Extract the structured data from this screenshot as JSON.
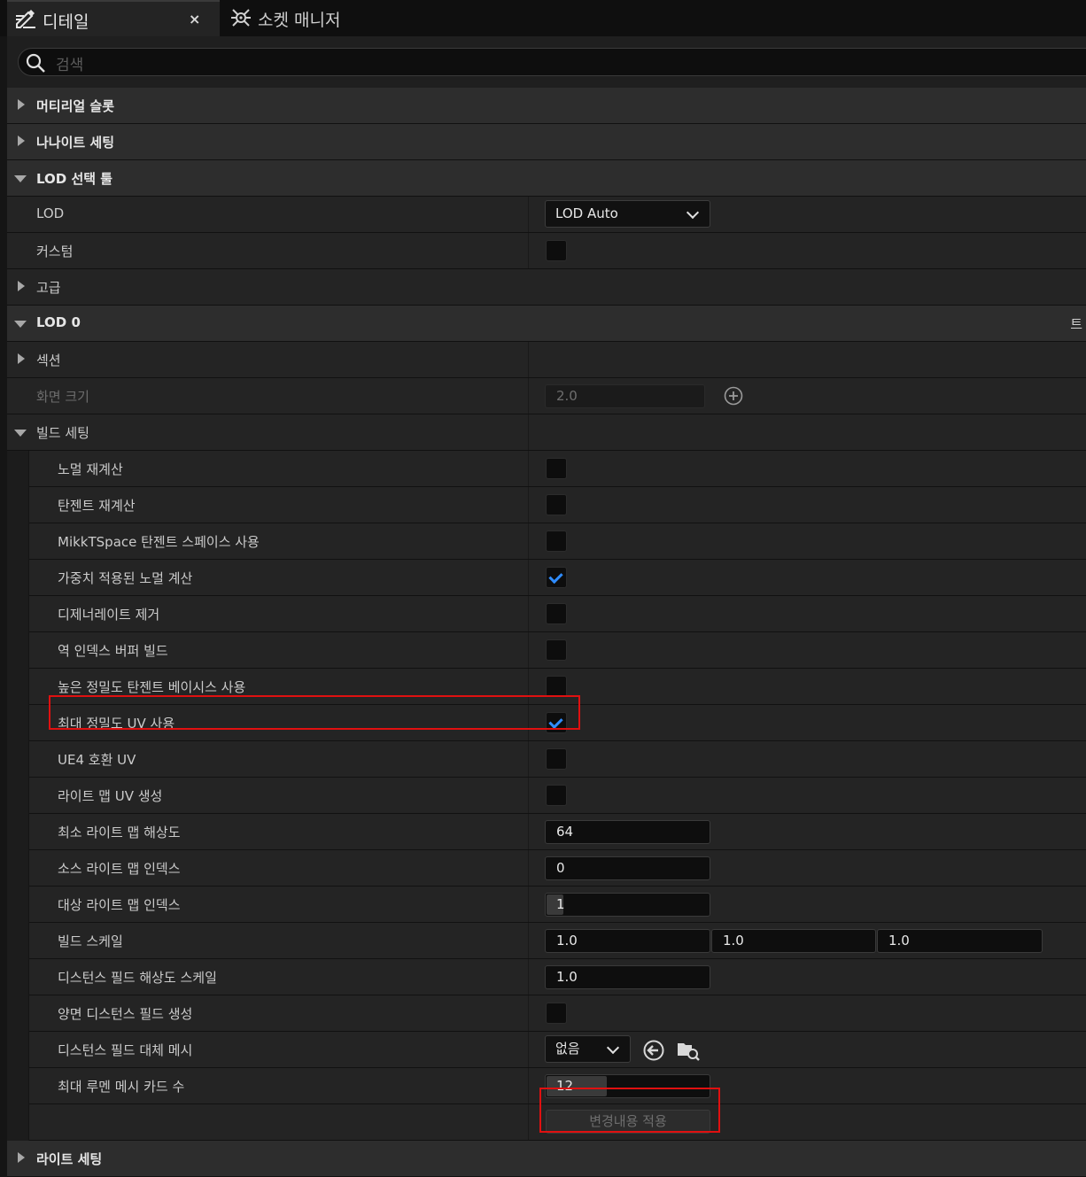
{
  "tabs": [
    {
      "label": "디테일",
      "icon": "pencil-list-icon",
      "close": "×"
    },
    {
      "label": "소켓 매니저",
      "icon": "socket-icon"
    }
  ],
  "search": {
    "placeholder": "검색",
    "icon": "search-icon"
  },
  "sections": {
    "material_slots": "머티리얼 슬롯",
    "nanite": "나나이트 세팅",
    "lod_picker": "LOD 선택 툴",
    "lod_label": "LOD",
    "lod_value": "LOD Auto",
    "custom": "커스텀",
    "advanced": "고급",
    "lod0": "LOD 0",
    "lod0_trailing": "트",
    "sections": "섹션",
    "screen_size": "화면 크기",
    "screen_size_value": "2.0",
    "build_settings": "빌드 세팅"
  },
  "build": {
    "recompute_normals": {
      "label": "노멀 재계산",
      "checked": false
    },
    "recompute_tangents": {
      "label": "탄젠트 재계산",
      "checked": false
    },
    "mikkt": {
      "label": "MikkTSpace 탄젠트 스페이스 사용",
      "checked": false
    },
    "weighted_normals": {
      "label": "가중치 적용된 노멀 계산",
      "checked": true
    },
    "remove_degenerates": {
      "label": "디제너레이트 제거",
      "checked": false
    },
    "reversed_index": {
      "label": "역 인덱스 버퍼 빌드",
      "checked": false
    },
    "high_precision_tangent": {
      "label": "높은 정밀도 탄젠트 베이시스 사용",
      "checked": false
    },
    "full_precision_uv": {
      "label": "최대 정밀도 UV 사용",
      "checked": true
    },
    "ue4_uv": {
      "label": "UE4 호환 UV",
      "checked": false
    },
    "gen_lightmap_uv": {
      "label": "라이트 맵 UV 생성",
      "checked": false
    },
    "min_lightmap_res": {
      "label": "최소 라이트 맵 해상도",
      "value": "64"
    },
    "src_lightmap_idx": {
      "label": "소스 라이트 맵 인덱스",
      "value": "0"
    },
    "dst_lightmap_idx": {
      "label": "대상 라이트 맵 인덱스",
      "value": "1",
      "fill": 0.1
    },
    "build_scale": {
      "label": "빌드 스케일",
      "x": "1.0",
      "y": "1.0",
      "z": "1.0"
    },
    "df_res_scale": {
      "label": "디스턴스 필드 해상도 스케일",
      "value": "1.0"
    },
    "two_sided_df": {
      "label": "양면 디스턴스 필드 생성",
      "checked": false
    },
    "df_replacement": {
      "label": "디스턴스 필드 대체 메시",
      "value": "없음"
    },
    "max_lumen_cards": {
      "label": "최대 루멘 메시 카드 수",
      "value": "12",
      "fill": 0.37
    },
    "apply_button": "변경내용 적용"
  },
  "next_section_partial": "라이트 세팅"
}
